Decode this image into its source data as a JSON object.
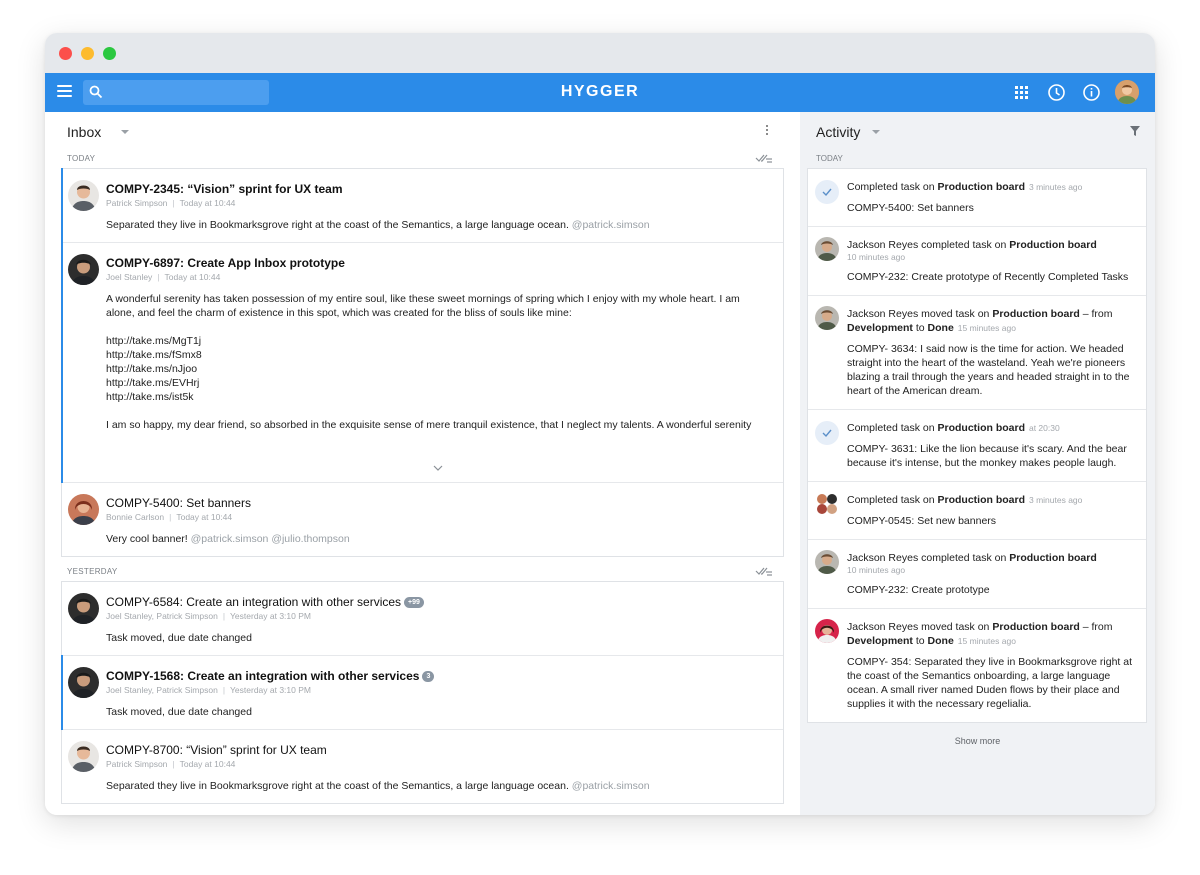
{
  "header": {
    "brand": "HYGGER"
  },
  "inbox": {
    "title": "Inbox",
    "sections": [
      {
        "label": "TODAY",
        "items": [
          {
            "title": "COMPY-2345: “Vision” sprint for UX team",
            "author": "Patrick Simpson",
            "time": "Today at 10:44",
            "body": "Separated they live in Bookmarksgrove right at the coast of the Semantics, a large language ocean.",
            "mention": "@patrick.simson"
          },
          {
            "title": "COMPY-6897: Create App Inbox prototype",
            "author": "Joel Stanley",
            "time": "Today at 10:44",
            "body": "A wonderful serenity has taken possession of my entire soul, like these sweet mornings of spring which I enjoy with my whole heart. I am alone, and feel the charm of existence in this spot, which was created for the bliss of souls like mine:",
            "links": [
              "http://take.ms/MgT1j",
              "http://take.ms/fSmx8",
              "http://take.ms/nJjoo",
              "http://take.ms/EVHrj",
              "http://take.ms/ist5k"
            ],
            "body2": "I am so happy, my dear friend, so absorbed in the exquisite sense of mere tranquil existence, that I neglect my talents. A wonderful serenity"
          },
          {
            "title": "COMPY-5400: Set banners",
            "author": "Bonnie Carlson",
            "time": "Today at 10:44",
            "body": "Very cool banner!",
            "mention": "@patrick.simson @julio.thompson"
          }
        ]
      },
      {
        "label": "YESTERDAY",
        "items": [
          {
            "title": "COMPY-6584: Create an integration with other services",
            "badge": "+99",
            "author": "Joel Stanley, Patrick Simpson",
            "time": "Yesterday at 3:10 PM",
            "body": "Task moved, due date changed"
          },
          {
            "title": "COMPY-1568: Create an integration with other services",
            "badge": "3",
            "author": "Joel Stanley, Patrick Simpson",
            "time": "Yesterday at 3:10 PM",
            "body": "Task moved, due date changed"
          },
          {
            "title": "COMPY-8700: “Vision” sprint for UX team",
            "author": "Patrick Simpson",
            "time": "Today at 10:44",
            "body": "Separated they live in Bookmarksgrove right at the coast of the Semantics, a large language ocean.",
            "mention": "@patrick.simson"
          }
        ]
      }
    ]
  },
  "activity": {
    "title": "Activity",
    "section_label": "TODAY",
    "items": [
      {
        "pre": "Completed task on",
        "board": "Production board",
        "time": "3 minutes ago",
        "body": "COMPY-5400: Set banners"
      },
      {
        "pre": "Jackson Reyes completed task on",
        "board": "Production board",
        "time": "10 minutes ago",
        "body": "COMPY-232: Create prototype of Recently Completed Tasks"
      },
      {
        "pre": "Jackson Reyes moved task on",
        "board": "Production board",
        "mid": "– from",
        "from": "Development",
        "to_word": "to",
        "to": "Done",
        "time": "15 minutes ago",
        "body": "COMPY- 3634: I said now is the time for action. We headed straight into the heart of the wasteland. Yeah we're pioneers blazing a trail through the years and headed straight in to the heart of the American dream."
      },
      {
        "pre": "Completed task on",
        "board": "Production board",
        "time": "at 20:30",
        "body": "COMPY- 3631: Like the lion because it's scary. And the bear because it's intense, but the monkey makes people laugh."
      },
      {
        "pre": "Completed task on",
        "board": "Production board",
        "time": "3 minutes ago",
        "body": "COMPY-0545: Set new banners"
      },
      {
        "pre": "Jackson Reyes completed task on",
        "board": "Production board",
        "time": "10 minutes ago",
        "body": "COMPY-232: Create prototype"
      },
      {
        "pre": "Jackson Reyes moved task on",
        "board": "Production board",
        "mid": "– from",
        "from": "Development",
        "to_word": "to",
        "to": "Done",
        "time": "15 minutes ago",
        "body": "COMPY- 354: Separated they live in Bookmarksgrove right at the coast of the Semantics onboarding, a large language ocean. A small river named Duden flows by their place and supplies it with the necessary regelialia."
      }
    ],
    "show_more": "Show more"
  },
  "colors": {
    "brand": "#2b8be8",
    "unread_bar": "#2b8be8",
    "activity_bg": "#f0f2f5"
  }
}
